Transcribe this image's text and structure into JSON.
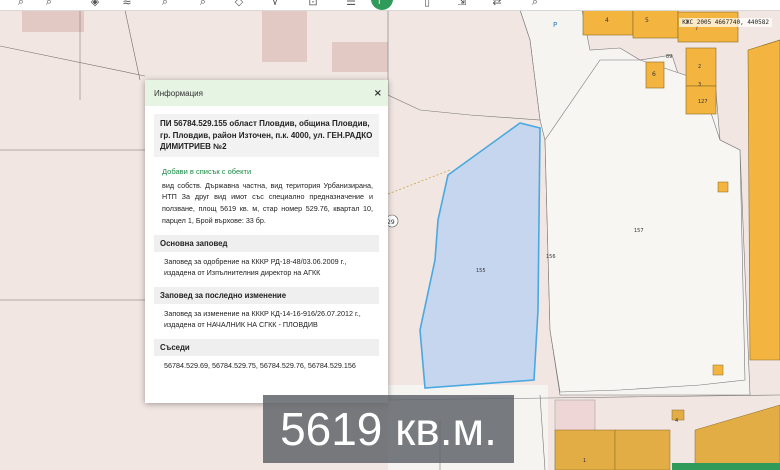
{
  "toolbar": {
    "icons": [
      "zoom-in-icon",
      "zoom-out-icon",
      "layers-icon",
      "stack-icon",
      "search-icon",
      "measure-icon",
      "location-icon",
      "add-point-icon",
      "list-icon",
      "info-icon",
      "document-icon",
      "ruler-icon",
      "print-icon",
      "transfer-icon",
      "zoom-icon",
      "share-icon"
    ]
  },
  "coords_readout": "КЖС 2005 4667740, 440582",
  "map": {
    "parcel_numbers": [
      "4",
      "5",
      "6",
      "7",
      "89",
      "155",
      "156",
      "157",
      "29",
      "1",
      "2",
      "3",
      "127",
      "4"
    ],
    "letters": [
      "P"
    ],
    "highlight_color": "#4aa8e0",
    "highlight_fill": "#c6d6ef"
  },
  "panel": {
    "title": "Информация",
    "close": "×",
    "object_title": "ПИ 56784.529.155 област Пловдив, община Пловдив, гр. Пловдив, район Източен, п.к. 4000, ул. ГЕН.РАДКО ДИМИТРИЕВ №2",
    "add_link": "Добави в списък с обекти",
    "description": "вид собств. Държавна частна, вид територия Урбанизирана, НТП За друг вид имот със специално предназначение и ползване, площ 5619 кв. м, стар номер 529.76, квартал 10, парцел 1, Брой върхове: 33 бр.",
    "sections": [
      {
        "heading": "Основна заповед",
        "text": "Заповед за одобрение на КККР РД-18-48/03.06.2009 г., издадена от Изпълнителния директор на АГКК"
      },
      {
        "heading": "Заповед за последно изменение",
        "text": "Заповед за изменение на КККР КД-14-16-916/26.07.2012 г., издадена от НАЧАЛНИК НА СГКК - ПЛОВДИВ"
      },
      {
        "heading": "Съседи",
        "text": "56784.529.69, 56784.529.75, 56784.529.76, 56784.529.156"
      }
    ]
  },
  "area_overlay": "5619 кв.м."
}
